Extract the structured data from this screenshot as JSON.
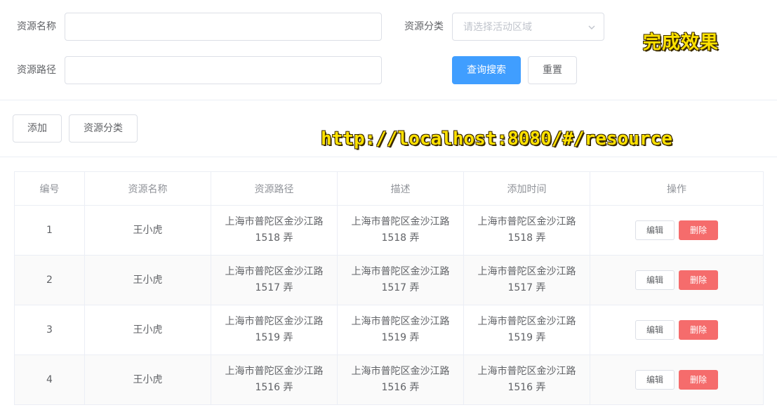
{
  "search_form": {
    "name_label": "资源名称",
    "name_value": "",
    "category_label": "资源分类",
    "category_placeholder": "请选择活动区域",
    "path_label": "资源路径",
    "path_value": "",
    "search_button": "查询搜索",
    "reset_button": "重置"
  },
  "toolbar": {
    "add_button": "添加",
    "category_button": "资源分类"
  },
  "watermark": {
    "title": "完成效果",
    "url": "http://localhost:8080/#/resource"
  },
  "table": {
    "columns": [
      "编号",
      "资源名称",
      "资源路径",
      "描述",
      "添加时间",
      "操作"
    ],
    "edit_label": "编辑",
    "delete_label": "删除",
    "rows": [
      {
        "id": "1",
        "name": "王小虎",
        "path": "上海市普陀区金沙江路 1518 弄",
        "desc": "上海市普陀区金沙江路 1518 弄",
        "time": "上海市普陀区金沙江路 1518 弄"
      },
      {
        "id": "2",
        "name": "王小虎",
        "path": "上海市普陀区金沙江路 1517 弄",
        "desc": "上海市普陀区金沙江路 1517 弄",
        "time": "上海市普陀区金沙江路 1517 弄"
      },
      {
        "id": "3",
        "name": "王小虎",
        "path": "上海市普陀区金沙江路 1519 弄",
        "desc": "上海市普陀区金沙江路 1519 弄",
        "time": "上海市普陀区金沙江路 1519 弄"
      },
      {
        "id": "4",
        "name": "王小虎",
        "path": "上海市普陀区金沙江路 1516 弄",
        "desc": "上海市普陀区金沙江路 1516 弄",
        "time": "上海市普陀区金沙江路 1516 弄"
      }
    ]
  },
  "colors": {
    "primary": "#409eff",
    "danger": "#f56c6c",
    "stripe": "#fafafa",
    "border": "#ebeef5"
  }
}
